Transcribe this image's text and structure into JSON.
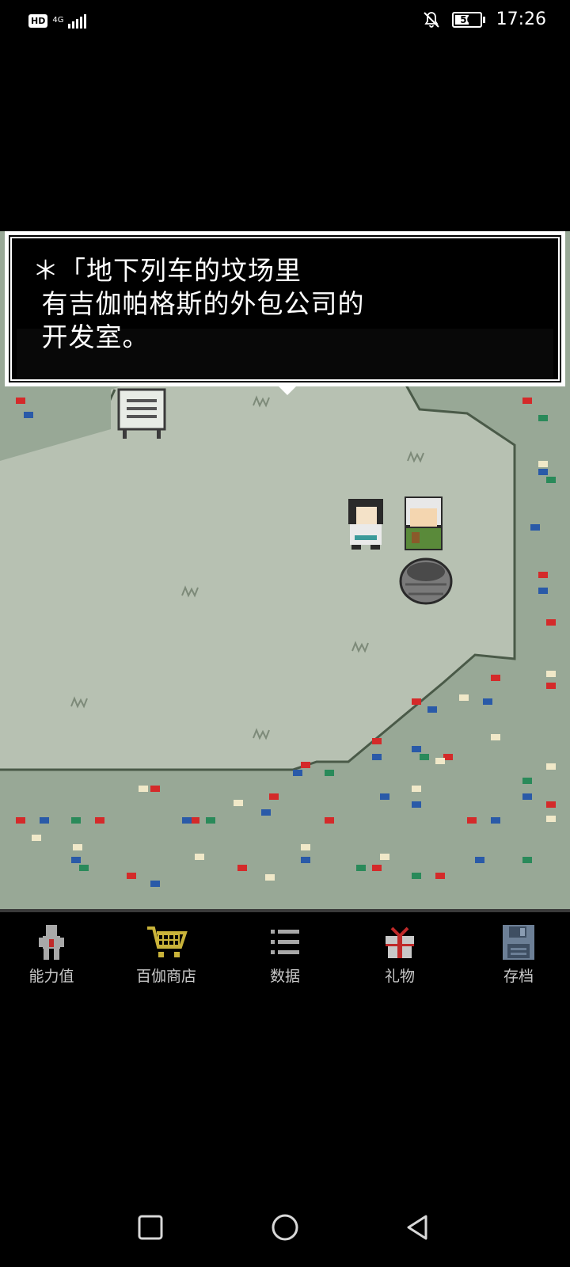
{
  "status_bar": {
    "hd_badge": "HD",
    "network": "4G",
    "battery_level": "50",
    "time": "17:26"
  },
  "dialog": {
    "line1": "＊「地下列车的坟场里",
    "line2": " 有吉伽帕格斯的外包公司的",
    "line3": " 开发室。"
  },
  "menu": {
    "items": [
      {
        "label": "能力值",
        "icon": "character-icon",
        "color": "#b0b0b0"
      },
      {
        "label": "百伽商店",
        "icon": "shopping-cart-icon",
        "color": "#c9b33a"
      },
      {
        "label": "数据",
        "icon": "list-icon",
        "color": "#b0b0b0"
      },
      {
        "label": "礼物",
        "icon": "gift-icon",
        "color": "#c9c9c9"
      },
      {
        "label": "存档",
        "icon": "save-disk-icon",
        "color": "#6c7f96"
      }
    ]
  },
  "colors": {
    "ground": "#b7c1b2",
    "grass": "#98a896",
    "dialog_bg": "#000000",
    "dialog_border": "#ffffff"
  }
}
